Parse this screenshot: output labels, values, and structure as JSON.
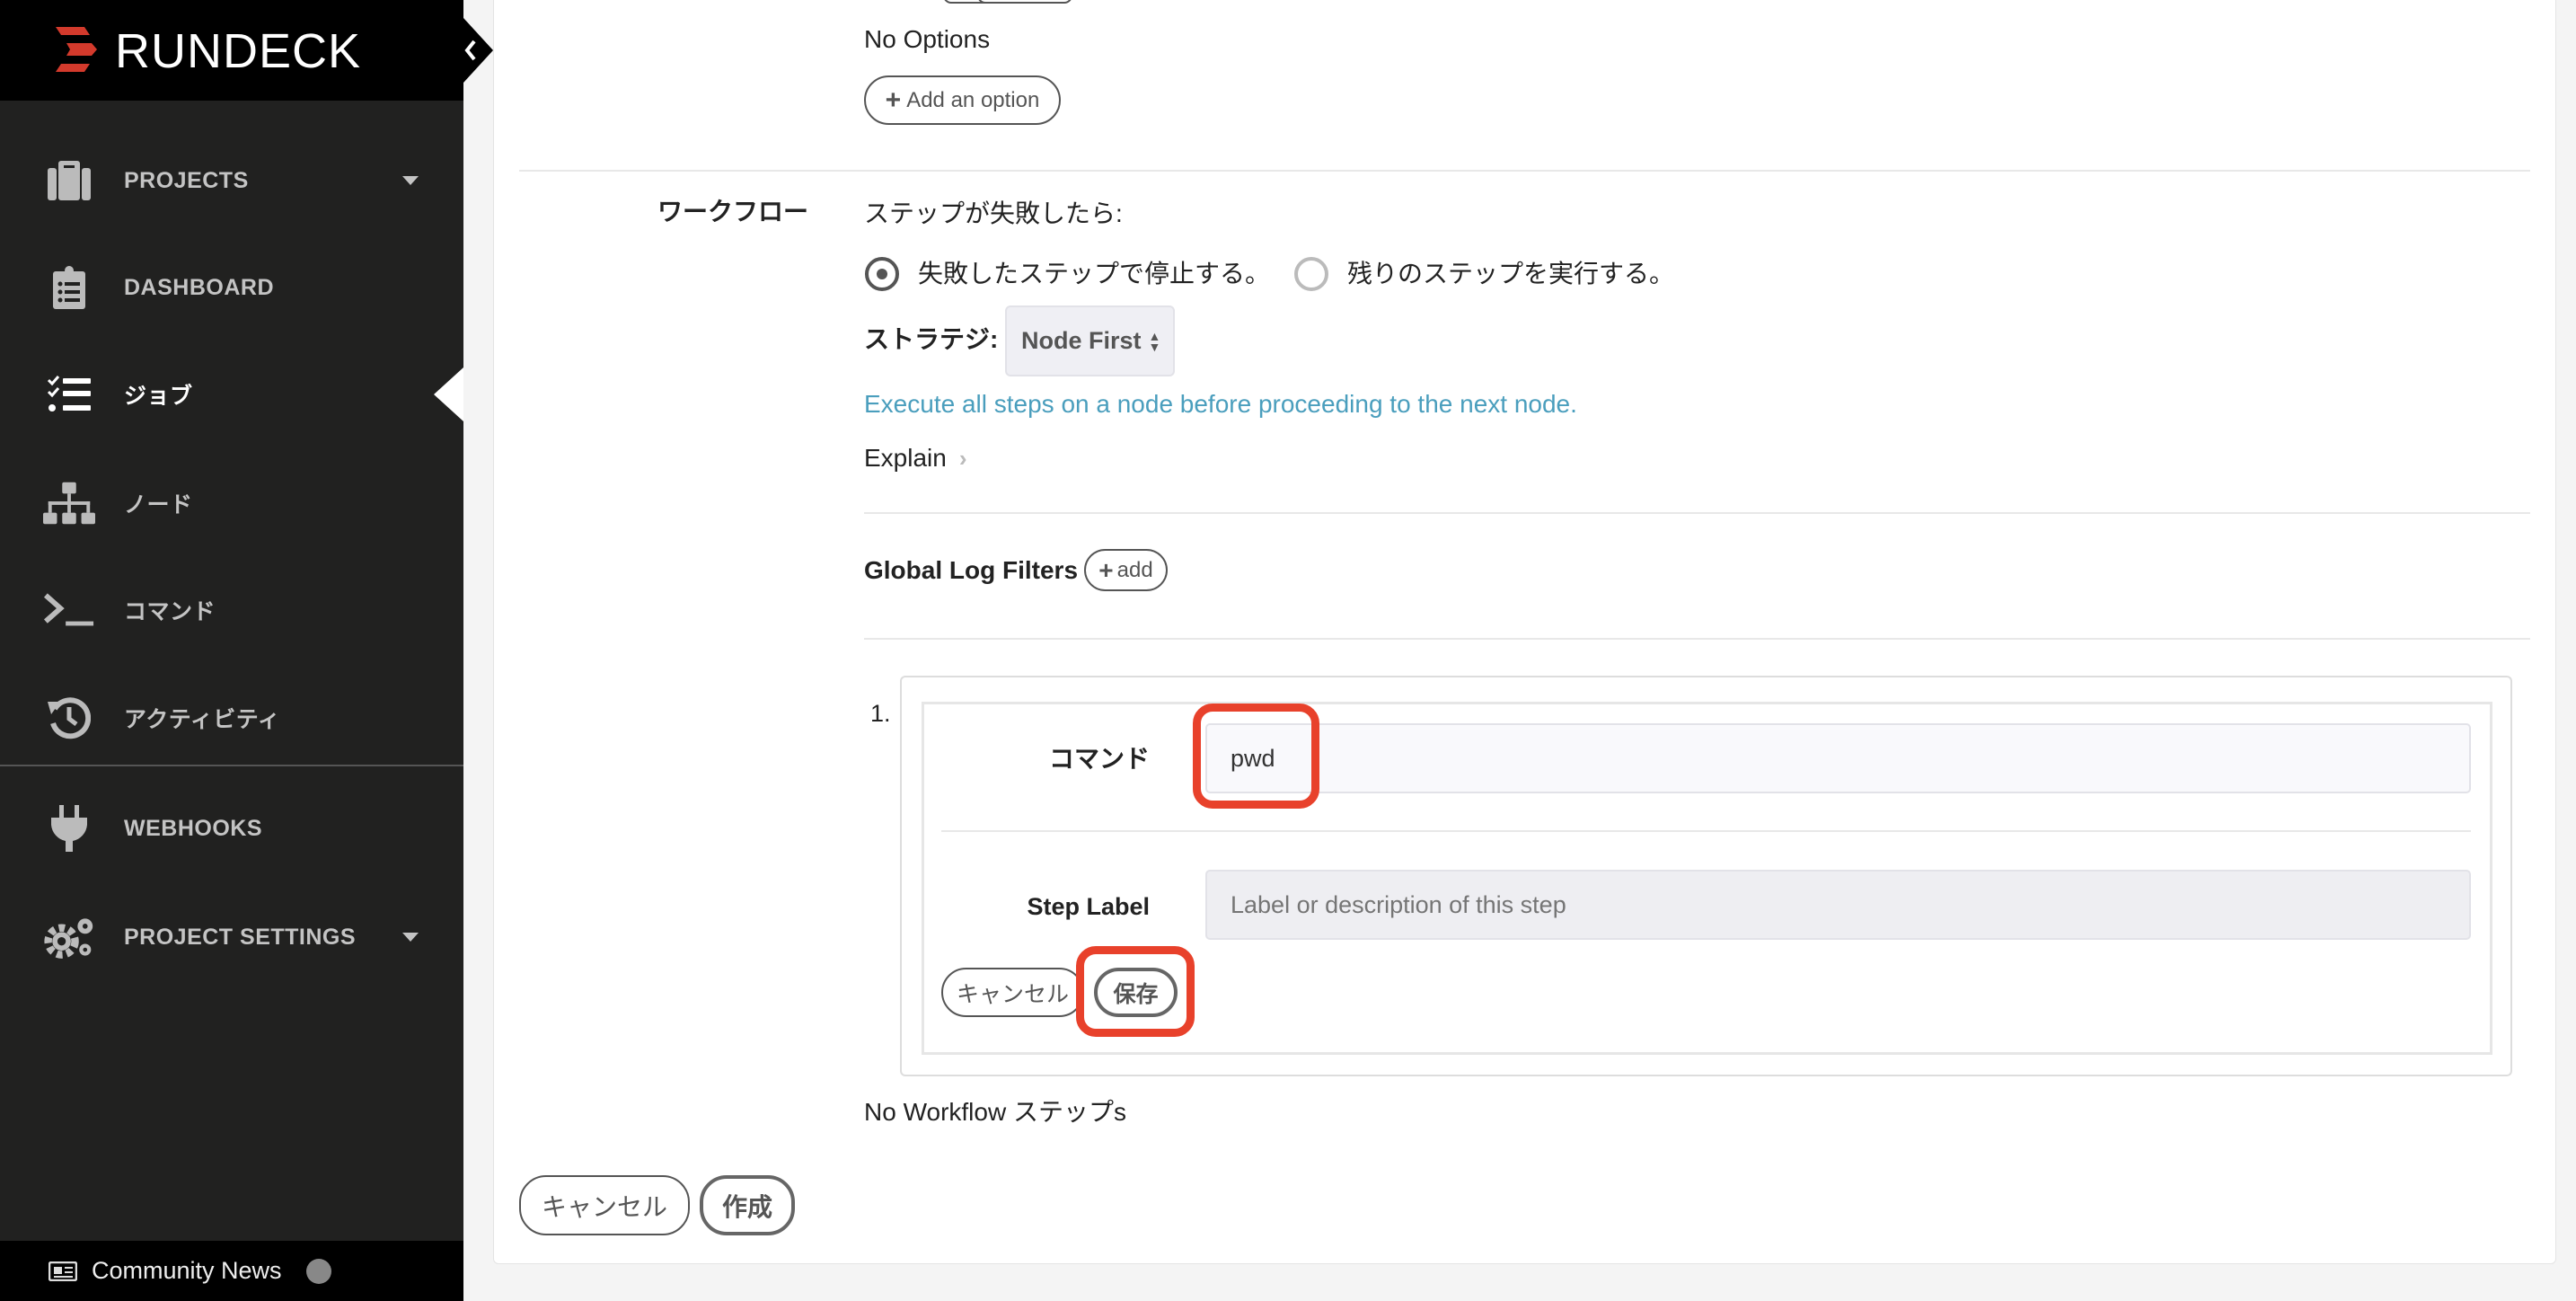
{
  "sidebar": {
    "logo": "RUNDECK",
    "items": [
      {
        "label": "PROJECTS",
        "icon": "briefcase-icon",
        "dropdown": true
      },
      {
        "label": "DASHBOARD",
        "icon": "clipboard-list-icon"
      },
      {
        "label": "ジョブ",
        "icon": "task-list-icon",
        "active": true
      },
      {
        "label": "ノード",
        "icon": "sitemap-icon"
      },
      {
        "label": "コマンド",
        "icon": "terminal-icon"
      },
      {
        "label": "アクティビティ",
        "icon": "history-icon"
      },
      {
        "label": "WEBHOOKS",
        "icon": "plug-icon"
      },
      {
        "label": "PROJECT SETTINGS",
        "icon": "gears-icon",
        "dropdown": true
      }
    ],
    "community_news": "Community News"
  },
  "options": {
    "empty_text": "No Options",
    "add_button": "Add an option"
  },
  "workflow": {
    "label": "ワークフロー",
    "on_failure_label": "ステップが失敗したら:",
    "radio_stop": "失敗したステップで停止する。",
    "radio_continue": "残りのステップを実行する。",
    "selected": "stop",
    "strategy_label": "ストラテジ:",
    "strategy_value": "Node First",
    "strategy_help": "Execute all steps on a node before proceeding to the next node.",
    "explain": "Explain",
    "global_log_filters": "Global Log Filters",
    "add_filter": "add",
    "step": {
      "number": "1.",
      "command_label": "コマンド",
      "command_value": "pwd",
      "step_label": "Step Label",
      "step_label_placeholder": "Label or description of this step",
      "cancel": "キャンセル",
      "save": "保存"
    },
    "no_steps": "No Workflow ステップs"
  },
  "footer": {
    "cancel": "キャンセル",
    "create": "作成"
  },
  "colors": {
    "highlight": "#e8412b",
    "link": "#4a9ebd",
    "sidebar": "#212120"
  }
}
